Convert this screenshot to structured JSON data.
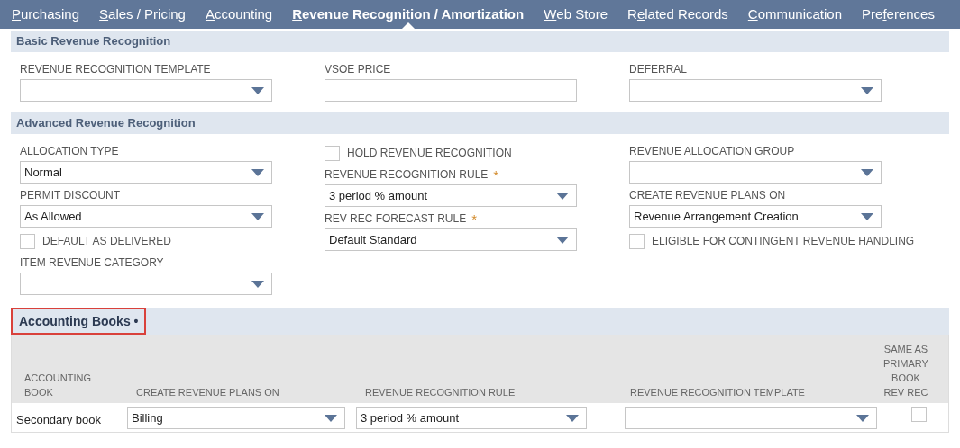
{
  "tabs": [
    {
      "key": "P",
      "post": "urchasing",
      "selected": false
    },
    {
      "key": "S",
      "post": "ales / Pricing",
      "selected": false
    },
    {
      "key": "A",
      "post": "ccounting",
      "selected": false
    },
    {
      "key": "R",
      "post": "evenue Recognition / Amortization",
      "selected": true
    },
    {
      "key": "W",
      "post": "eb Store",
      "selected": false
    },
    {
      "pre": "R",
      "key": "e",
      "post": "lated Records",
      "selected": false
    },
    {
      "key": "C",
      "post": "ommunication",
      "selected": false
    },
    {
      "pre": "Pre",
      "key": "f",
      "post": "erences",
      "selected": false
    }
  ],
  "sections": [
    {
      "title": "Basic Revenue Recognition",
      "columns": [
        [
          {
            "kind": "select",
            "label": "REVENUE RECOGNITION TEMPLATE"
          }
        ],
        [
          {
            "kind": "text",
            "label": "VSOE PRICE"
          }
        ],
        [
          {
            "kind": "select",
            "label": "DEFERRAL"
          }
        ]
      ]
    },
    {
      "title": "Advanced Revenue Recognition",
      "columns": [
        [
          {
            "kind": "select",
            "label": "ALLOCATION TYPE",
            "value": "Normal"
          },
          {
            "kind": "select",
            "label": "PERMIT DISCOUNT",
            "value": "As Allowed"
          },
          {
            "kind": "checkbox",
            "label": "DEFAULT AS DELIVERED",
            "checked": false
          },
          {
            "kind": "select",
            "label": "ITEM REVENUE CATEGORY"
          }
        ],
        [
          {
            "kind": "checkbox",
            "label": "HOLD REVENUE RECOGNITION",
            "checked": false
          },
          {
            "kind": "select",
            "label": "REVENUE RECOGNITION RULE",
            "value": "3 period % amount",
            "required_mark": "*"
          },
          {
            "kind": "select",
            "label": "REV REC FORECAST RULE",
            "value": "Default Standard",
            "required_mark": "*"
          }
        ],
        [
          {
            "kind": "select",
            "label": "REVENUE ALLOCATION GROUP"
          },
          {
            "kind": "select",
            "label": "CREATE REVENUE PLANS ON",
            "value": "Revenue Arrangement Creation"
          },
          {
            "kind": "checkbox",
            "label": "ELIGIBLE FOR CONTINGENT REVENUE HANDLING",
            "checked": false
          }
        ]
      ]
    }
  ],
  "books": {
    "title_pre": "Accoun",
    "title_key": "t",
    "title_post": "ing Books",
    "marker": "•",
    "columns": [
      "ACCOUNTING BOOK",
      "CREATE REVENUE PLANS ON",
      "REVENUE RECOGNITION RULE",
      "REVENUE RECOGNITION TEMPLATE",
      "SAME AS PRIMARY BOOK REV REC"
    ],
    "rows": [
      {
        "book": "Secondary book",
        "plans_on": "Billing",
        "rule": "3 period % amount",
        "same_as_primary": false
      }
    ]
  }
}
